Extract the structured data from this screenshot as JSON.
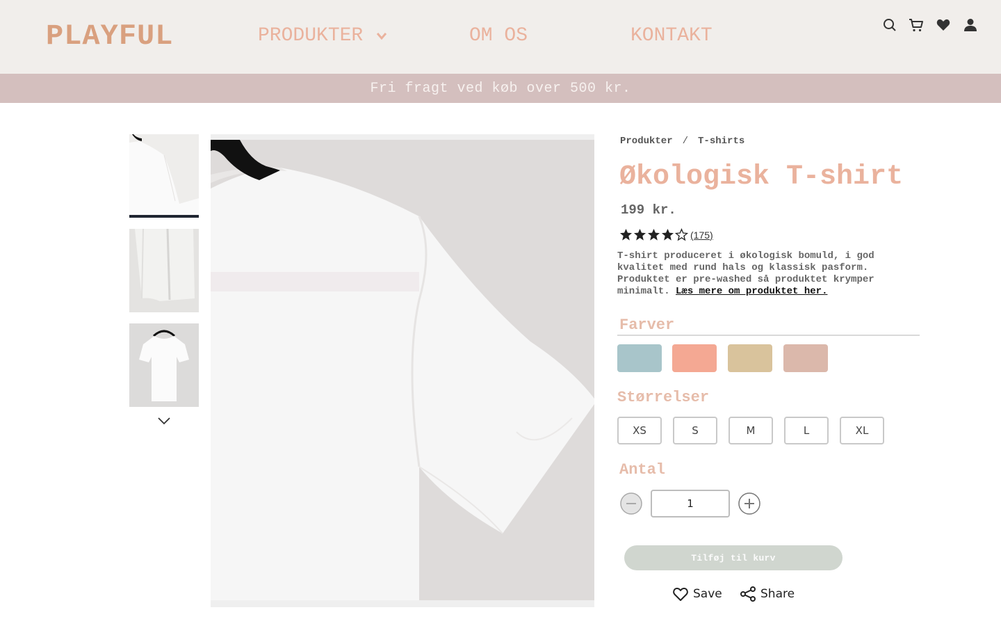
{
  "header": {
    "logo": "PLAYFUL",
    "nav": [
      {
        "label": "PRODUKTER",
        "has_dropdown": true
      },
      {
        "label": "OM OS"
      },
      {
        "label": "KONTAKT"
      }
    ],
    "icons": [
      "search-icon",
      "cart-icon",
      "heart-icon",
      "user-icon"
    ]
  },
  "banner": {
    "text": "Fri fragt ved køb over 500 kr."
  },
  "gallery": {
    "thumbnails": [
      "thumbnail-shoulder",
      "thumbnail-hem",
      "thumbnail-hanger"
    ],
    "selected_index": 0
  },
  "breadcrumb": {
    "items": [
      "Produkter",
      "T-shirts"
    ],
    "separator": "/"
  },
  "product": {
    "title": "Økologisk T-shirt",
    "price": "199 kr.",
    "rating": 4,
    "rating_max": 5,
    "reviews": "(175)",
    "description": "T-shirt produceret i økologisk bomuld, i god kvalitet med rund hals og klassisk pasform. Produktet er pre-washed så produktet krymper minimalt.",
    "read_more": "Læs mere om produktet her."
  },
  "colors": {
    "label": "Farver",
    "swatches": [
      "#a8c5ca",
      "#f4a893",
      "#d9c39c",
      "#dbb8ab"
    ]
  },
  "sizes": {
    "label": "Størrelser",
    "options": [
      "XS",
      "S",
      "M",
      "L",
      "XL"
    ]
  },
  "quantity": {
    "label": "Antal",
    "value": "1"
  },
  "actions": {
    "add_to_cart": "Tilføj til kurv",
    "save": "Save",
    "share": "Share"
  },
  "colors_theme": {
    "logo": "#d9a07f",
    "nav": "#eab29d",
    "banner": "#d4bfbe",
    "cta_disabled": "#d0d6cf"
  }
}
